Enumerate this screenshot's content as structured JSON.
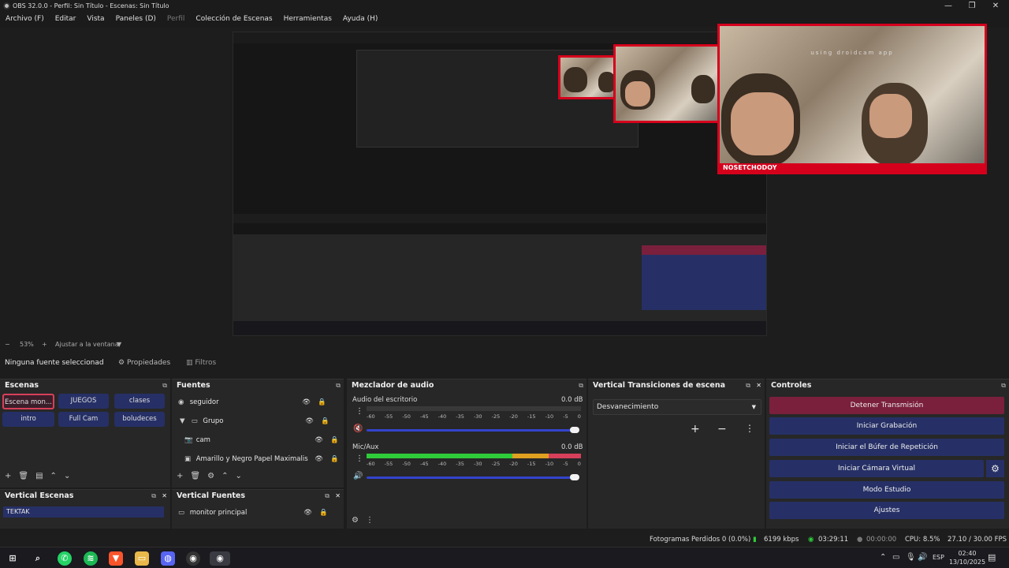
{
  "window": {
    "title": "OBS 32.0.0 - Perfil: Sin Título - Escenas: Sin Título",
    "min": "—",
    "max": "❐",
    "close": "✕"
  },
  "menu": [
    "Archivo (F)",
    "Editar",
    "Vista",
    "Paneles (D)",
    "Perfil",
    "Colección de Escenas",
    "Herramientas",
    "Ayuda (H)"
  ],
  "preview": {
    "watermark": "using droidcam app",
    "caption": "NOSETCHODOY"
  },
  "zoom": {
    "level": "53%",
    "fit_label": "Ajustar a la ventana"
  },
  "source_bar": {
    "no_source": "Ninguna fuente seleccionad",
    "properties": "Propiedades",
    "filters": "Filtros"
  },
  "scenes": {
    "title": "Escenas",
    "items": [
      "Escena mon...",
      "JUEGOS",
      "clases",
      "intro",
      "Full Cam",
      "boludeces"
    ]
  },
  "sources": {
    "title": "Fuentes",
    "items": [
      "seguidor",
      "Grupo",
      "cam",
      "Amarillo y Negro Papel Maximalis"
    ]
  },
  "mixer": {
    "title": "Mezclador de audio",
    "channels": [
      {
        "name": "Audio del escritorio",
        "db": "0.0 dB"
      },
      {
        "name": "Mic/Aux",
        "db": "0.0 dB"
      }
    ],
    "scale": [
      "-60",
      "-55",
      "-50",
      "-45",
      "-40",
      "-35",
      "-30",
      "-25",
      "-20",
      "-15",
      "-10",
      "-5",
      "0"
    ]
  },
  "transitions": {
    "title": "Vertical Transiciones de escena",
    "selected": "Desvanecimiento"
  },
  "controls": {
    "title": "Controles",
    "buttons": [
      "Detener Transmisión",
      "Iniciar Grabación",
      "Iniciar el Búfer de Repetición",
      "Iniciar Cámara Virtual",
      "Modo Estudio",
      "Ajustes"
    ]
  },
  "vertical_scenes": {
    "title": "Vertical Escenas",
    "item": "TEKTAK"
  },
  "vertical_sources": {
    "title": "Vertical Fuentes",
    "item": "monitor principal"
  },
  "status": {
    "dropped": "Fotogramas Perdidos 0 (0.0%)",
    "kbps": "6199 kbps",
    "live_time": "03:29:11",
    "rec_time": "00:00:00",
    "cpu": "CPU: 8.5%",
    "fps": "27.10 / 30.00 FPS"
  },
  "taskbar": {
    "lang": "ESP",
    "time": "02:40",
    "date": "13/10/2025"
  }
}
